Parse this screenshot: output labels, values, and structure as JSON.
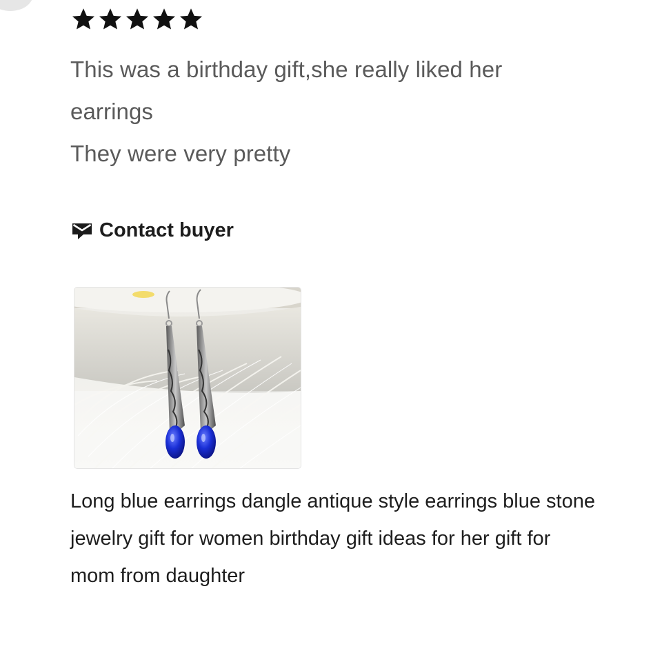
{
  "review": {
    "rating": 5,
    "rating_max": 5,
    "star_color": "#111111",
    "text_lines": [
      "This was a birthday gift,she really liked her",
      "earrings",
      "They were very pretty"
    ]
  },
  "contact": {
    "icon": "message-flag-icon",
    "label": "Contact buyer"
  },
  "product": {
    "image_alt": "blue-earrings-photo",
    "title_lines": [
      "Long blue earrings dangle antique style earrings blue stone",
      "jewelry gift for women birthday gift ideas for her gift for",
      "mom from daughter"
    ]
  }
}
